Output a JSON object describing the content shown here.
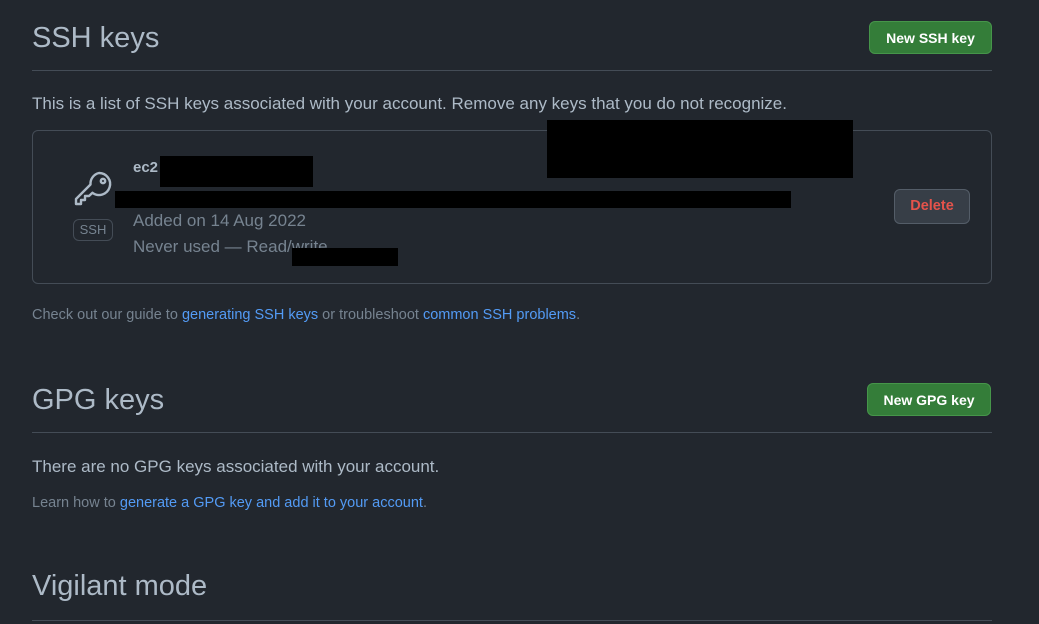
{
  "ssh": {
    "title": "SSH keys",
    "new_button": "New SSH key",
    "description": "This is a list of SSH keys associated with your account. Remove any keys that you do not recognize.",
    "key": {
      "title": "ec2",
      "badge": "SSH",
      "added": "Added on 14 Aug 2022",
      "usage": "Never used — Read/write",
      "delete_button": "Delete"
    },
    "guide": {
      "prefix": "Check out our guide to ",
      "link1": "generating SSH keys",
      "middle": " or troubleshoot ",
      "link2": "common SSH problems",
      "suffix": "."
    }
  },
  "gpg": {
    "title": "GPG keys",
    "new_button": "New GPG key",
    "empty_text": "There are no GPG keys associated with your account.",
    "learn": {
      "prefix": "Learn how to ",
      "link": "generate a GPG key and add it to your account",
      "suffix": "."
    }
  },
  "vigilant": {
    "title": "Vigilant mode"
  },
  "colors": {
    "background": "#22272e",
    "green_button": "#347d39",
    "link": "#539bf5",
    "danger": "#e5534b"
  }
}
